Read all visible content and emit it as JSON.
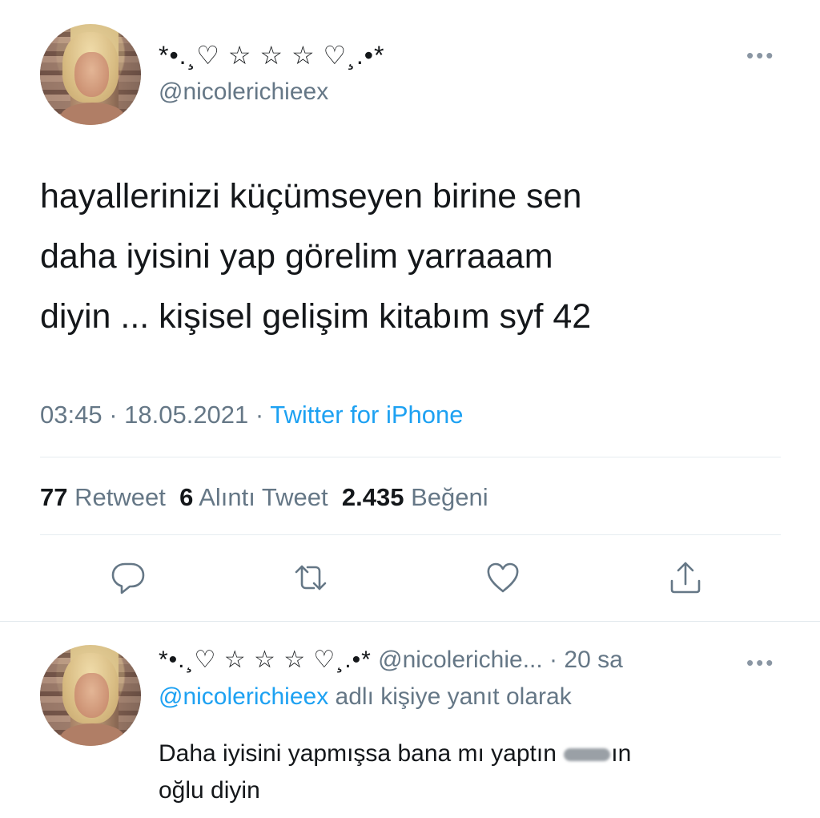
{
  "tweet": {
    "author_name": "*•.¸♡ ☆ ☆ ☆ ♡¸.•*",
    "author_handle": "@nicolerichieex",
    "more_label": "•••",
    "text": "hayallerinizi küçümseyen birine sen\ndaha iyisini yap görelim yarraaam\ndiyin ... kişisel gelişim kitabım syf 42",
    "time": "03:45 · 18.05.2021 · ",
    "source": "Twitter for iPhone",
    "stats": {
      "retweets_count": "77",
      "retweets_label": "Retweet",
      "quotes_count": "6",
      "quotes_label": "Alıntı Tweet",
      "likes_count": "2.435",
      "likes_label": "Beğeni"
    },
    "actions": [
      "reply-icon",
      "retweet-icon",
      "like-icon",
      "share-icon"
    ]
  },
  "reply": {
    "author_name": "*•.¸♡ ☆ ☆ ☆ ♡¸.•*",
    "author_handle": "@nicolerichie...",
    "age": " · 20 sa",
    "more_label": "•••",
    "replying_to_handle": "@nicolerichieex",
    "replying_to_suffix": " adlı kişiye yanıt olarak",
    "text_before": "Daha iyisini yapmışsa bana mı yaptın ",
    "text_after": "ın",
    "text_line2": "oğlu diyin"
  },
  "colors": {
    "accent": "#1da1f2",
    "secondary_text": "#657786",
    "primary_text": "#14171a",
    "divider": "#e6ecf0"
  }
}
